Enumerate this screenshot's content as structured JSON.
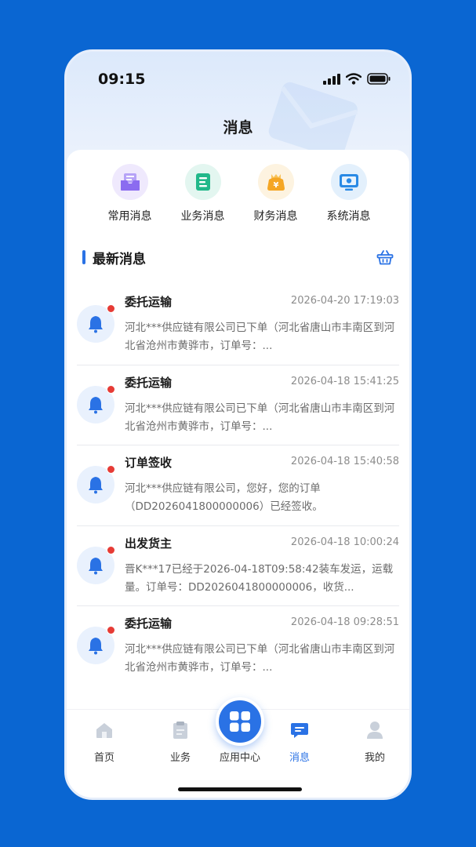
{
  "status_bar": {
    "time": "09:15"
  },
  "page": {
    "title": "消息"
  },
  "categories": [
    {
      "label": "常用消息",
      "icon": "inbox-icon",
      "color": "#8b6cf0",
      "bg": "#efe9fd"
    },
    {
      "label": "业务消息",
      "icon": "document-icon",
      "color": "#22b88a",
      "bg": "#e3f6f0"
    },
    {
      "label": "财务消息",
      "icon": "money-bag-icon",
      "color": "#f5a623",
      "bg": "#fdf3e0"
    },
    {
      "label": "系统消息",
      "icon": "monitor-icon",
      "color": "#2a8ae5",
      "bg": "#e3f0fc"
    }
  ],
  "section": {
    "title": "最新消息"
  },
  "messages": [
    {
      "title": "委托运输",
      "time": "2026-04-20 17:19:03",
      "body": "河北***供应链有限公司已下单（河北省唐山市丰南区到河北省沧州市黄骅市，订单号：..."
    },
    {
      "title": "委托运输",
      "time": "2026-04-18 15:41:25",
      "body": "河北***供应链有限公司已下单（河北省唐山市丰南区到河北省沧州市黄骅市，订单号：..."
    },
    {
      "title": "订单签收",
      "time": "2026-04-18 15:40:58",
      "body": "河北***供应链有限公司，您好，您的订单（DD2026041800000006）已经签收。"
    },
    {
      "title": "出发货主",
      "time": "2026-04-18 10:00:24",
      "body": "晋K***17已经于2026-04-18T09:58:42装车发运，运载量。订单号：DD2026041800000006，收货..."
    },
    {
      "title": "委托运输",
      "time": "2026-04-18 09:28:51",
      "body": "河北***供应链有限公司已下单（河北省唐山市丰南区到河北省沧州市黄骅市，订单号：..."
    }
  ],
  "tabs": [
    {
      "label": "首页",
      "icon": "home-icon"
    },
    {
      "label": "业务",
      "icon": "clipboard-icon"
    },
    {
      "label": "应用中心",
      "icon": "apps-grid-icon"
    },
    {
      "label": "消息",
      "icon": "chat-icon",
      "active": true
    },
    {
      "label": "我的",
      "icon": "user-icon"
    }
  ],
  "colors": {
    "accent": "#2a72e5",
    "background": "#0a66d2",
    "badge": "#e63b35"
  }
}
